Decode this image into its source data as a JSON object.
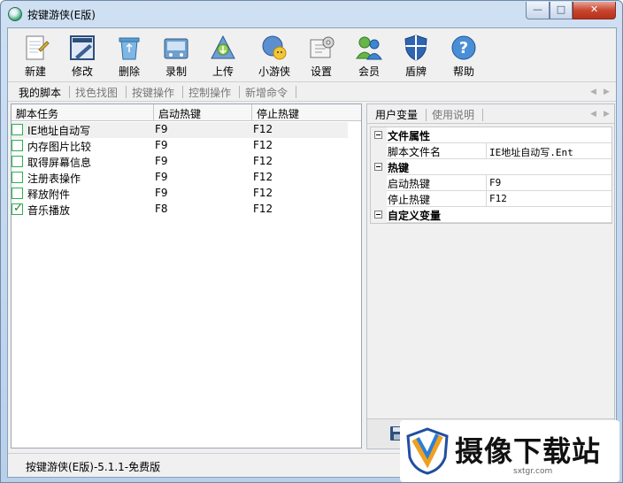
{
  "window": {
    "title": "按键游侠(E版)",
    "controls": {
      "min": "—",
      "max": "□",
      "close": "✕"
    }
  },
  "toolbar": {
    "buttons": [
      {
        "label": "新建",
        "icon": "new-document-icon"
      },
      {
        "label": "修改",
        "icon": "edit-icon"
      },
      {
        "label": "删除",
        "icon": "recycle-bin-icon"
      },
      {
        "label": "录制",
        "icon": "record-icon"
      },
      {
        "label": "上传",
        "icon": "upload-icon"
      },
      {
        "label": "小游侠",
        "icon": "mini-ranger-icon"
      },
      {
        "label": "设置",
        "icon": "settings-icon"
      },
      {
        "label": "会员",
        "icon": "members-icon"
      },
      {
        "label": "盾牌",
        "icon": "shield-icon"
      },
      {
        "label": "帮助",
        "icon": "help-icon"
      }
    ]
  },
  "tabs": [
    "我的脚本",
    "找色找图",
    "按键操作",
    "控制操作",
    "新增命令"
  ],
  "script_table": {
    "columns": [
      "脚本任务",
      "启动热键",
      "停止热键"
    ],
    "rows": [
      {
        "name": "IE地址自动写",
        "start": "F9",
        "stop": "F12",
        "checked": false
      },
      {
        "name": "内存图片比较",
        "start": "F9",
        "stop": "F12",
        "checked": false
      },
      {
        "name": "取得屏幕信息",
        "start": "F9",
        "stop": "F12",
        "checked": false
      },
      {
        "name": "注册表操作",
        "start": "F9",
        "stop": "F12",
        "checked": false
      },
      {
        "name": "释放附件",
        "start": "F9",
        "stop": "F12",
        "checked": false
      },
      {
        "name": "音乐播放",
        "start": "F8",
        "stop": "F12",
        "checked": true
      }
    ]
  },
  "right_tabs": [
    "用户变量",
    "使用说明"
  ],
  "property_grid": {
    "file_props": {
      "category": "文件属性",
      "name_label": "脚本文件名",
      "name_value": "IE地址自动写.Ent"
    },
    "hotkey": {
      "category": "热键",
      "start_label": "启动热键",
      "start_value": "F9",
      "stop_label": "停止热键",
      "stop_value": "F12"
    },
    "custom_vars": {
      "category": "自定义变量"
    }
  },
  "status": {
    "text": "按键游侠(E版)-5.1.1-免费版"
  },
  "watermark": {
    "text": "摄像下载站",
    "url": "sxtgr.com"
  }
}
